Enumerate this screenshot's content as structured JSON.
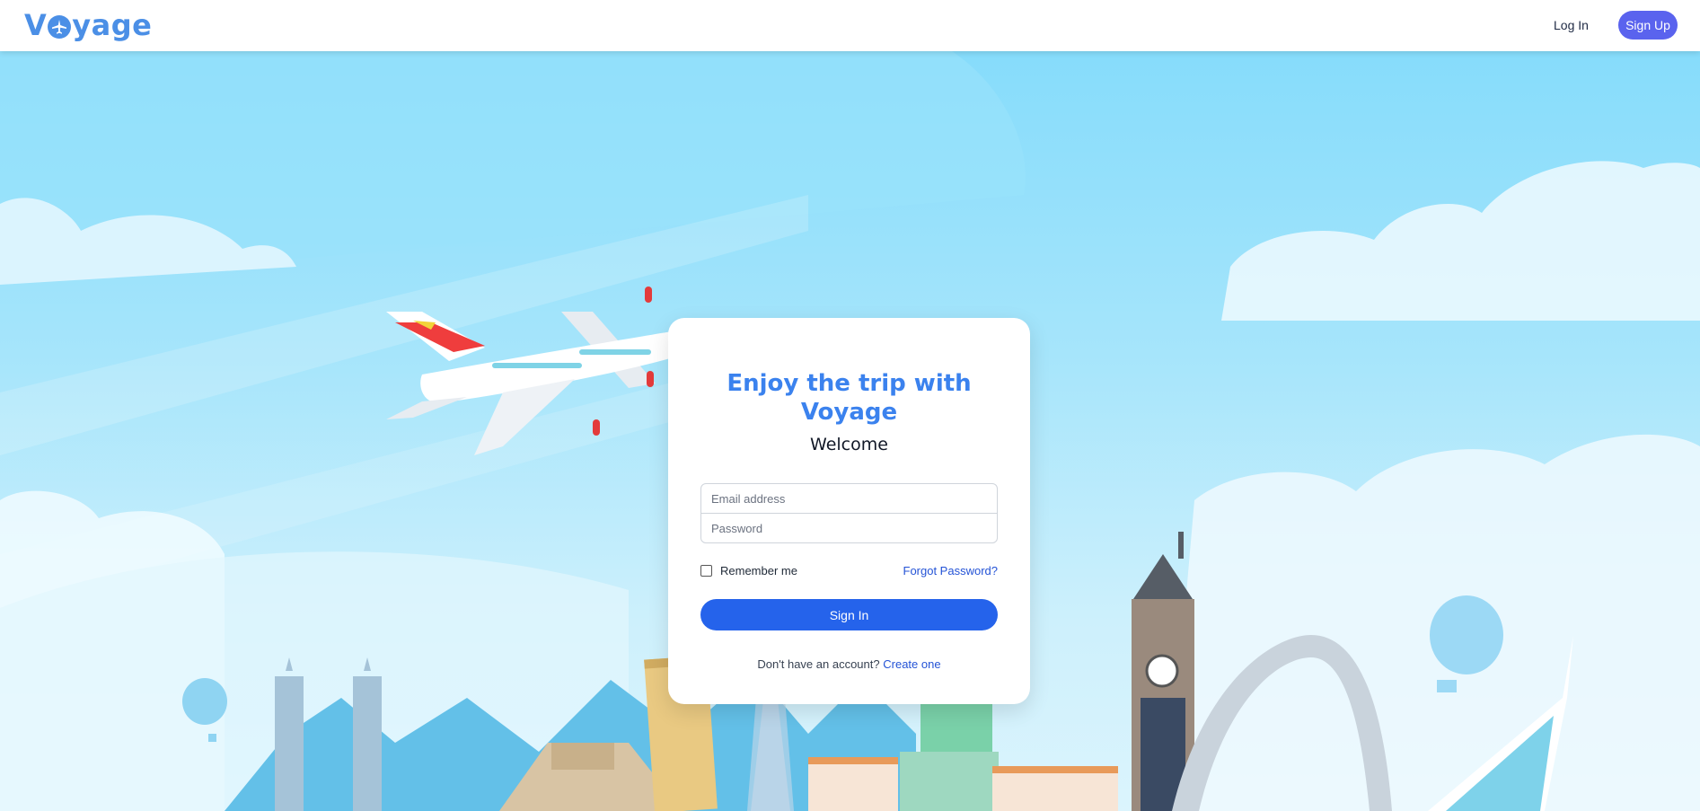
{
  "nav": {
    "brand": "Voyage",
    "login_label": "Log In",
    "signup_label": "Sign Up"
  },
  "login_card": {
    "title": "Enjoy the trip with Voyage",
    "subtitle": "Welcome",
    "email_placeholder": "Email address",
    "password_placeholder": "Password",
    "remember_label": "Remember me",
    "forgot_label": "Forgot Password?",
    "signin_label": "Sign In",
    "no_account_text": "Don't have an account?",
    "create_label": "Create one"
  },
  "colors": {
    "brand": "#4b8fe6",
    "title": "#3b82ee",
    "primary_button": "#2563eb",
    "signup_button": "#5a63ee",
    "link": "#2453d6",
    "sky": "#86dcfb"
  },
  "icons": {
    "logo_o": "airplane-icon"
  }
}
